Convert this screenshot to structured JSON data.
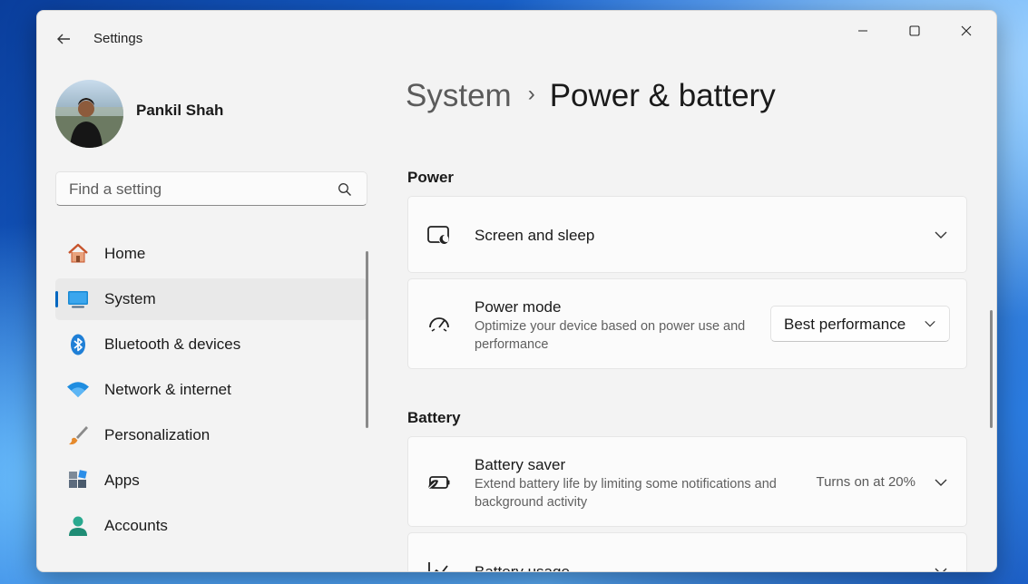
{
  "window": {
    "title": "Settings"
  },
  "user": {
    "name": "Pankil Shah"
  },
  "search": {
    "placeholder": "Find a setting"
  },
  "sidebar": {
    "items": [
      {
        "label": "Home",
        "icon": "home-icon"
      },
      {
        "label": "System",
        "icon": "system-icon",
        "active": true
      },
      {
        "label": "Bluetooth & devices",
        "icon": "bluetooth-icon"
      },
      {
        "label": "Network & internet",
        "icon": "wifi-icon"
      },
      {
        "label": "Personalization",
        "icon": "brush-icon"
      },
      {
        "label": "Apps",
        "icon": "apps-icon"
      },
      {
        "label": "Accounts",
        "icon": "accounts-icon"
      }
    ]
  },
  "breadcrumb": {
    "parent": "System",
    "current": "Power & battery"
  },
  "power": {
    "heading": "Power",
    "screen_sleep": {
      "title": "Screen and sleep"
    },
    "power_mode": {
      "title": "Power mode",
      "description": "Optimize your device based on power use and performance",
      "selected": "Best performance"
    }
  },
  "battery": {
    "heading": "Battery",
    "battery_saver": {
      "title": "Battery saver",
      "description": "Extend battery life by limiting some notifications and background activity",
      "status": "Turns on at 20%"
    },
    "battery_usage": {
      "title": "Battery usage"
    }
  },
  "colors": {
    "accent": "#0067c0",
    "window_bg": "#f3f3f3",
    "card_bg": "#fbfbfb"
  }
}
